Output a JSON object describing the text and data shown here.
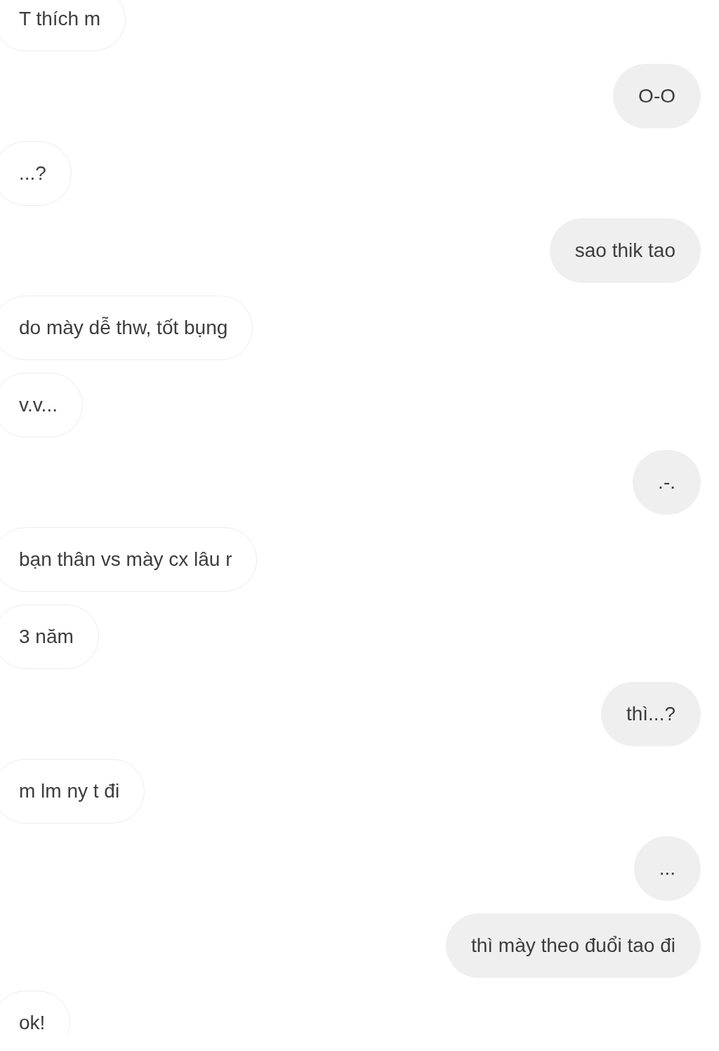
{
  "messages": [
    {
      "kind": "received",
      "text": "T thích m"
    },
    {
      "kind": "sent",
      "text": "O-O"
    },
    {
      "kind": "received",
      "text": "...?"
    },
    {
      "kind": "sent",
      "text": "sao thik tao"
    },
    {
      "kind": "received",
      "text": "do mày dễ thw, tốt bụng"
    },
    {
      "kind": "received",
      "text": "v.v..."
    },
    {
      "kind": "sent",
      "text": ".-."
    },
    {
      "kind": "received",
      "text": "bạn thân vs mày cx lâu r"
    },
    {
      "kind": "received",
      "text": "3 năm"
    },
    {
      "kind": "sent",
      "text": "thì...?"
    },
    {
      "kind": "received",
      "text": "m lm ny t đi"
    },
    {
      "kind": "sent",
      "text": "..."
    },
    {
      "kind": "sent",
      "text": "thì mày theo đuổi tao đi"
    },
    {
      "kind": "received",
      "text": "ok!"
    }
  ]
}
